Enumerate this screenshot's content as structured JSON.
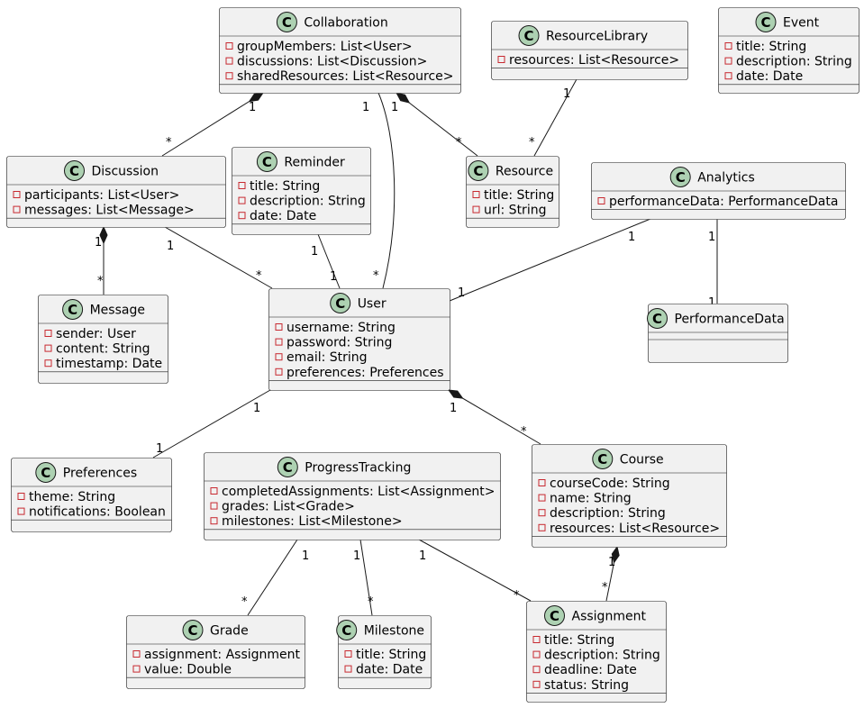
{
  "colors": {
    "box_fill": "#F1F1F1",
    "box_border": "#181818",
    "class_badge": "#ADD1B2",
    "private_marker": "#C82930",
    "line": "#181818"
  },
  "badge_letter": "C",
  "classes": [
    {
      "id": "Collaboration",
      "name": "Collaboration",
      "attributes": [
        "groupMembers: List<User>",
        "discussions: List<Discussion>",
        "sharedResources: List<Resource>"
      ]
    },
    {
      "id": "ResourceLibrary",
      "name": "ResourceLibrary",
      "attributes": [
        "resources: List<Resource>"
      ]
    },
    {
      "id": "Event",
      "name": "Event",
      "attributes": [
        "title: String",
        "description: String",
        "date: Date"
      ]
    },
    {
      "id": "Discussion",
      "name": "Discussion",
      "attributes": [
        "participants: List<User>",
        "messages: List<Message>"
      ]
    },
    {
      "id": "Reminder",
      "name": "Reminder",
      "attributes": [
        "title: String",
        "description: String",
        "date: Date"
      ]
    },
    {
      "id": "Resource",
      "name": "Resource",
      "attributes": [
        "title: String",
        "url: String"
      ]
    },
    {
      "id": "Analytics",
      "name": "Analytics",
      "attributes": [
        "performanceData: PerformanceData"
      ]
    },
    {
      "id": "Message",
      "name": "Message",
      "attributes": [
        "sender: User",
        "content: String",
        "timestamp: Date"
      ]
    },
    {
      "id": "User",
      "name": "User",
      "attributes": [
        "username: String",
        "password: String",
        "email: String",
        "preferences: Preferences"
      ]
    },
    {
      "id": "PerformanceData",
      "name": "PerformanceData",
      "attributes": []
    },
    {
      "id": "Preferences",
      "name": "Preferences",
      "attributes": [
        "theme: String",
        "notifications: Boolean"
      ]
    },
    {
      "id": "ProgressTracking",
      "name": "ProgressTracking",
      "attributes": [
        "completedAssignments: List<Assignment>",
        "grades: List<Grade>",
        "milestones: List<Milestone>"
      ]
    },
    {
      "id": "Course",
      "name": "Course",
      "attributes": [
        "courseCode: String",
        "name: String",
        "description: String",
        "resources: List<Resource>"
      ]
    },
    {
      "id": "Grade",
      "name": "Grade",
      "attributes": [
        "assignment: Assignment",
        "value: Double"
      ]
    },
    {
      "id": "Milestone",
      "name": "Milestone",
      "attributes": [
        "title: String",
        "date: Date"
      ]
    },
    {
      "id": "Assignment",
      "name": "Assignment",
      "attributes": [
        "title: String",
        "description: String",
        "deadline: Date",
        "status: String"
      ]
    }
  ],
  "relations": [
    {
      "from": "Collaboration",
      "to": "Discussion",
      "kind": "composition",
      "from_mult": "1",
      "to_mult": "*"
    },
    {
      "from": "Collaboration",
      "to": "User",
      "kind": "association",
      "from_mult": "1",
      "to_mult": "*"
    },
    {
      "from": "Collaboration",
      "to": "Resource",
      "kind": "composition",
      "from_mult": "1",
      "to_mult": "*"
    },
    {
      "from": "ResourceLibrary",
      "to": "Resource",
      "kind": "association",
      "from_mult": "1",
      "to_mult": "*"
    },
    {
      "from": "Discussion",
      "to": "Message",
      "kind": "composition",
      "from_mult": "1",
      "to_mult": "*"
    },
    {
      "from": "Discussion",
      "to": "User",
      "kind": "association",
      "from_mult": "1",
      "to_mult": "*"
    },
    {
      "from": "Reminder",
      "to": "User",
      "kind": "association",
      "from_mult": "1",
      "to_mult": "1"
    },
    {
      "from": "Analytics",
      "to": "User",
      "kind": "association",
      "from_mult": "1",
      "to_mult": "1"
    },
    {
      "from": "Analytics",
      "to": "PerformanceData",
      "kind": "association",
      "from_mult": "1",
      "to_mult": "1"
    },
    {
      "from": "User",
      "to": "Preferences",
      "kind": "association",
      "from_mult": "1",
      "to_mult": "1"
    },
    {
      "from": "User",
      "to": "Course",
      "kind": "composition",
      "from_mult": "1",
      "to_mult": "*"
    },
    {
      "from": "ProgressTracking",
      "to": "Grade",
      "kind": "association",
      "from_mult": "1",
      "to_mult": "*"
    },
    {
      "from": "ProgressTracking",
      "to": "Milestone",
      "kind": "association",
      "from_mult": "1",
      "to_mult": "*"
    },
    {
      "from": "ProgressTracking",
      "to": "Assignment",
      "kind": "association",
      "from_mult": "1",
      "to_mult": "*"
    },
    {
      "from": "Course",
      "to": "Assignment",
      "kind": "composition",
      "from_mult": "1",
      "to_mult": "*"
    }
  ]
}
